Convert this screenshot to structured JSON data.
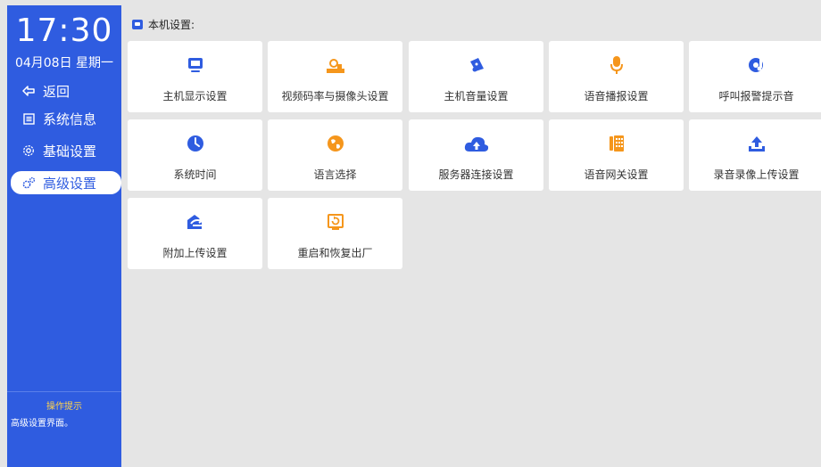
{
  "sidebar": {
    "time": "17:30",
    "date": "04月08日 星期一",
    "nav": [
      {
        "label": "返回"
      },
      {
        "label": "系统信息"
      },
      {
        "label": "基础设置"
      },
      {
        "label": "高级设置"
      }
    ],
    "hint_title": "操作提示",
    "hint_text": "高级设置界面。"
  },
  "main": {
    "section_title": "本机设置:",
    "cards": [
      {
        "label": "主机显示设置",
        "icon": "monitor-icon"
      },
      {
        "label": "视频码率与摄像头设置",
        "icon": "camera-settings-icon"
      },
      {
        "label": "主机音量设置",
        "icon": "speaker-icon"
      },
      {
        "label": "语音播报设置",
        "icon": "microphone-icon"
      },
      {
        "label": "呼叫报警提示音",
        "icon": "music-note-icon"
      },
      {
        "label": "系统时间",
        "icon": "clock-icon"
      },
      {
        "label": "语言选择",
        "icon": "globe-icon"
      },
      {
        "label": "服务器连接设置",
        "icon": "cloud-upload-icon"
      },
      {
        "label": "语音网关设置",
        "icon": "phone-gateway-icon"
      },
      {
        "label": "录音录像上传设置",
        "icon": "upload-icon"
      },
      {
        "label": "附加上传设置",
        "icon": "upload-extra-icon"
      },
      {
        "label": "重启和恢复出厂",
        "icon": "restart-icon"
      }
    ]
  },
  "colors": {
    "sidebar_bg": "#2f5ce0",
    "blue_icon": "#2f5ce0",
    "orange_icon": "#f5961c",
    "hint_title": "#ffd34d"
  }
}
